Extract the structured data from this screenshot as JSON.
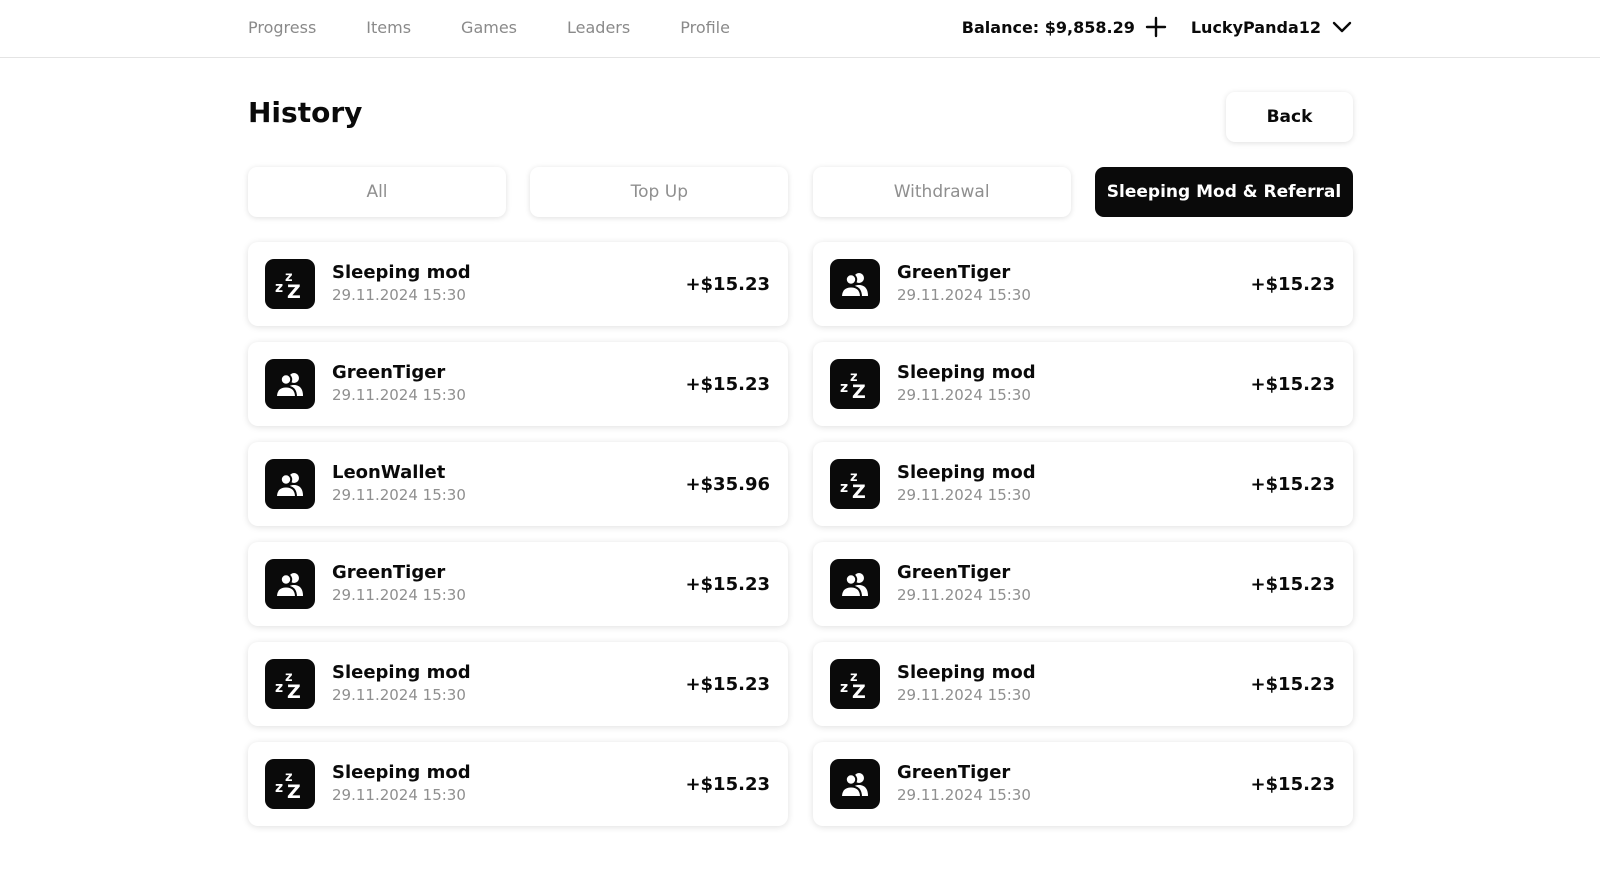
{
  "nav": {
    "items": [
      {
        "label": "Progress"
      },
      {
        "label": "Items"
      },
      {
        "label": "Games"
      },
      {
        "label": "Leaders"
      },
      {
        "label": "Profile"
      }
    ]
  },
  "account": {
    "balance": "Balance: $9,858.29",
    "username": "LuckyPanda12"
  },
  "page": {
    "title": "History",
    "back_label": "Back"
  },
  "tabs": [
    {
      "label": "All",
      "active": false
    },
    {
      "label": "Top Up",
      "active": false
    },
    {
      "label": "Withdrawal",
      "active": false
    },
    {
      "label": "Sleeping Mod & Referral",
      "active": true
    }
  ],
  "transactions": [
    {
      "icon": "sleep-icon",
      "title": "Sleeping mod",
      "date": "29.11.2024 15:30",
      "amount": "+$15.23"
    },
    {
      "icon": "users-icon",
      "title": "GreenTiger",
      "date": "29.11.2024 15:30",
      "amount": "+$15.23"
    },
    {
      "icon": "users-icon",
      "title": "GreenTiger",
      "date": "29.11.2024 15:30",
      "amount": "+$15.23"
    },
    {
      "icon": "sleep-icon",
      "title": "Sleeping mod",
      "date": "29.11.2024 15:30",
      "amount": "+$15.23"
    },
    {
      "icon": "users-icon",
      "title": "LeonWallet",
      "date": "29.11.2024 15:30",
      "amount": "+$35.96"
    },
    {
      "icon": "sleep-icon",
      "title": "Sleeping mod",
      "date": "29.11.2024 15:30",
      "amount": "+$15.23"
    },
    {
      "icon": "users-icon",
      "title": "GreenTiger",
      "date": "29.11.2024 15:30",
      "amount": "+$15.23"
    },
    {
      "icon": "users-icon",
      "title": "GreenTiger",
      "date": "29.11.2024 15:30",
      "amount": "+$15.23"
    },
    {
      "icon": "sleep-icon",
      "title": "Sleeping mod",
      "date": "29.11.2024 15:30",
      "amount": "+$15.23"
    },
    {
      "icon": "sleep-icon",
      "title": "Sleeping mod",
      "date": "29.11.2024 15:30",
      "amount": "+$15.23"
    },
    {
      "icon": "sleep-icon",
      "title": "Sleeping mod",
      "date": "29.11.2024 15:30",
      "amount": "+$15.23"
    },
    {
      "icon": "users-icon",
      "title": "GreenTiger",
      "date": "29.11.2024 15:30",
      "amount": "+$15.23"
    }
  ],
  "colors": {
    "primary": "#0a0a0a",
    "muted_text": "#8f8f8f",
    "background": "#ffffff"
  }
}
